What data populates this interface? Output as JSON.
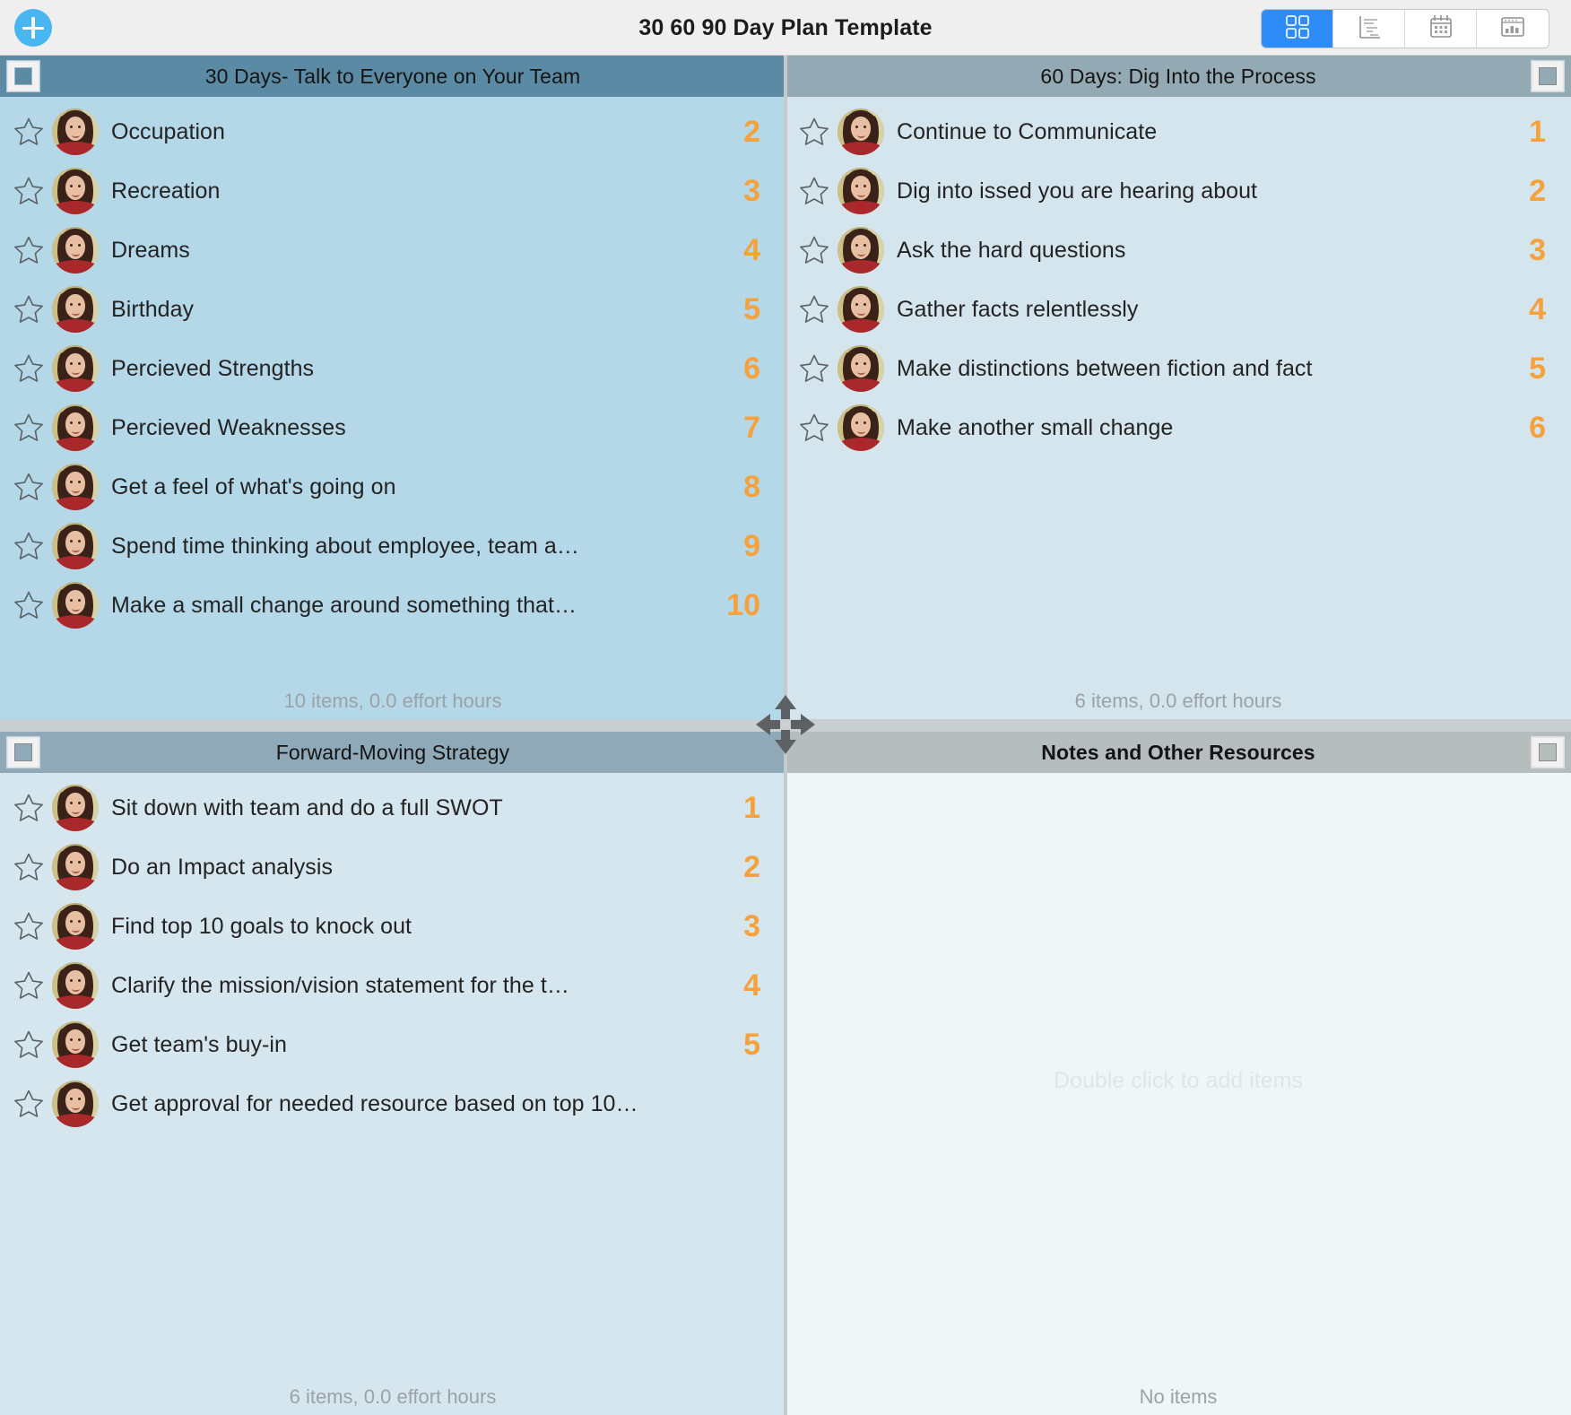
{
  "toolbar": {
    "add_button_label": "+",
    "title": "30 60 90 Day Plan Template",
    "views": [
      {
        "name": "grid-view",
        "icon": "grid-icon",
        "active": true
      },
      {
        "name": "outline-view",
        "icon": "outline-icon",
        "active": false
      },
      {
        "name": "calendar-view",
        "icon": "calendar-icon",
        "active": false
      },
      {
        "name": "chart-view",
        "icon": "chart-icon",
        "active": false
      }
    ]
  },
  "panes": {
    "top_left": {
      "title": "30 Days- Talk to Everyone on Your Team",
      "title_bold": false,
      "header_color": "#5b8ba4",
      "body_color": "#b4d8e8",
      "footer": "10 items, 0.0 effort hours",
      "items": [
        {
          "label": "Occupation",
          "rank": "2"
        },
        {
          "label": "Recreation",
          "rank": "3"
        },
        {
          "label": "Dreams",
          "rank": "4"
        },
        {
          "label": "Birthday",
          "rank": "5"
        },
        {
          "label": "Percieved Strengths",
          "rank": "6"
        },
        {
          "label": "Percieved Weaknesses",
          "rank": "7"
        },
        {
          "label": "Get a feel of what's going on",
          "rank": "8"
        },
        {
          "label": "Spend time thinking about employee, team a…",
          "rank": "9"
        },
        {
          "label": "Make a small change around something that…",
          "rank": "10"
        }
      ]
    },
    "top_right": {
      "title": "60 Days: Dig Into the Process",
      "title_bold": false,
      "header_color": "#93a9b3",
      "body_color": "#d4e5ee",
      "footer": "6 items, 0.0 effort hours",
      "items": [
        {
          "label": "Continue to Communicate",
          "rank": "1"
        },
        {
          "label": "Dig into issed you are hearing about",
          "rank": "2"
        },
        {
          "label": "Ask the hard questions",
          "rank": "3"
        },
        {
          "label": "Gather facts relentlessly",
          "rank": "4"
        },
        {
          "label": "Make distinctions between fiction and fact",
          "rank": "5"
        },
        {
          "label": "Make another small change",
          "rank": "6"
        }
      ]
    },
    "bottom_left": {
      "title": "Forward-Moving Strategy",
      "title_bold": false,
      "header_color": "#8fa9b8",
      "body_color": "#d5e6ef",
      "footer": "6 items, 0.0 effort hours",
      "items": [
        {
          "label": "Sit down with team and do a full SWOT",
          "rank": "1"
        },
        {
          "label": "Do an Impact analysis",
          "rank": "2"
        },
        {
          "label": "Find top 10 goals to knock out",
          "rank": "3"
        },
        {
          "label": "Clarify the mission/vision statement for the t…",
          "rank": "4"
        },
        {
          "label": "Get team's buy-in",
          "rank": "5"
        },
        {
          "label": "Get approval for needed resource based on top 10…",
          "rank": ""
        }
      ]
    },
    "bottom_right": {
      "title": "Notes and Other Resources",
      "title_bold": true,
      "header_color": "#b5bdbd",
      "body_color": "#eff6f6",
      "footer": "No items",
      "empty_hint": "Double click to add items",
      "items": []
    }
  },
  "colors": {
    "accent_orange": "#f5a13c",
    "add_button_blue": "#49b6f2",
    "active_view_blue": "#2d8cf5"
  }
}
